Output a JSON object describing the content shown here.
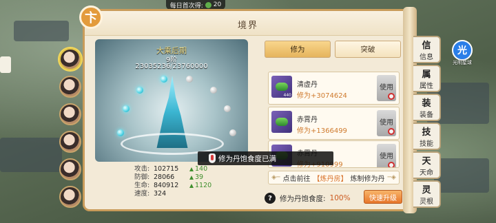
{
  "hud": {
    "daily_first": "每日首次得:",
    "daily_count": "20"
  },
  "panel": {
    "title": "境界",
    "logo": "卞"
  },
  "realm": {
    "stage": "大乘后期",
    "level": "9阶",
    "exp": "23035236/23760000"
  },
  "tabs": [
    {
      "label": "修为",
      "active": true
    },
    {
      "label": "突破",
      "active": false
    }
  ],
  "items": [
    {
      "name": "清虚丹",
      "gain": "修为+3074624",
      "count": "440",
      "use": "使用"
    },
    {
      "name": "赤霄丹",
      "gain": "修为+1366499",
      "count": "",
      "use": "使用"
    },
    {
      "name": "赤霄丹",
      "gain": "修为+910999",
      "count": "",
      "use": "使用"
    }
  ],
  "goto": {
    "prefix": "点击前往",
    "place": "【炼丹房】",
    "suffix": "炼制修为丹"
  },
  "fullness": {
    "label": "修为丹饱食度:",
    "value": "100%"
  },
  "quick_button": "快速升级",
  "toast": "修为丹饱食度已满",
  "stats": [
    {
      "label": "攻击:",
      "value": "102715",
      "inc": "140"
    },
    {
      "label": "防御:",
      "value": "28066",
      "inc": "39"
    },
    {
      "label": "生命:",
      "value": "840912",
      "inc": "1120"
    },
    {
      "label": "速度:",
      "value": "324",
      "inc": ""
    }
  ],
  "side_tabs": [
    {
      "glyph": "信",
      "label": "信息"
    },
    {
      "glyph": "属",
      "label": "属性"
    },
    {
      "glyph": "装",
      "label": "装备"
    },
    {
      "glyph": "技",
      "label": "技能"
    },
    {
      "glyph": "天",
      "label": "天命"
    },
    {
      "glyph": "灵",
      "label": "灵根"
    }
  ],
  "light_badge": {
    "glyph": "光",
    "label": "光明星球"
  },
  "colors": {
    "accent": "#e39b3c",
    "gain": "#cf7a2d",
    "panel_bg": "#f3ead7"
  }
}
